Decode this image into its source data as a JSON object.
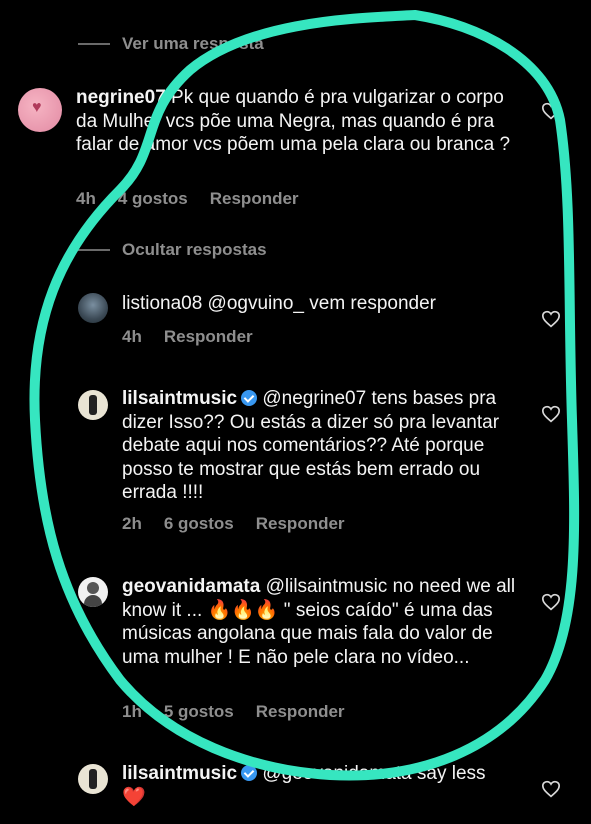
{
  "top_link": {
    "label": "Ver uma resposta"
  },
  "comments": [
    {
      "username": "negrine07",
      "text": " Pk que quando é pra vulgarizar o corpo da Mulher vcs põe uma Negra, mas quando é pra falar de amor vcs põem uma pela clara ou branca ?",
      "time": "4h",
      "likes": "4 gostos",
      "reply": "Responder"
    }
  ],
  "hide_replies": {
    "label": "Ocultar respostas"
  },
  "replies": [
    {
      "username": "listiona08",
      "text": " @ogvuino_ vem responder",
      "time": "4h",
      "likes": "",
      "reply": "Responder"
    },
    {
      "username": "lilsaintmusic",
      "text": " @negrine07 tens bases pra dizer Isso?? Ou estás a dizer só pra levantar debate aqui nos comentários?? Até porque posso te mostrar que estás bem errado ou errada !!!!",
      "time": "2h",
      "likes": "6 gostos",
      "reply": "Responder"
    },
    {
      "username": "geovanidamata",
      "text_a": " @lilsaintmusic no need we all know it ... ",
      "emoji": "🔥🔥🔥",
      "text_b": " \" seios caído\" é uma das músicas angolana que mais fala do valor de uma mulher ! E não pele clara no vídeo...",
      "time": "1h",
      "likes": "5 gostos",
      "reply": "Responder"
    },
    {
      "username": "lilsaintmusic",
      "text": " @geovanidamata say less",
      "emoji": "❤️"
    }
  ],
  "colors": {
    "background": "#000000",
    "annotation": "#36e6c0",
    "verified": "#3897f0",
    "muted": "#8e8e8e"
  }
}
